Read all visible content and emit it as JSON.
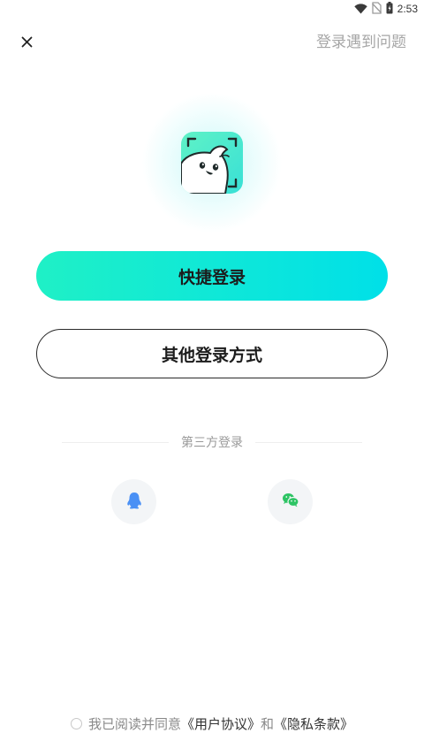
{
  "status_bar": {
    "time": "2:53",
    "icons": [
      "wifi-icon",
      "no-sim-icon",
      "battery-icon"
    ]
  },
  "top_bar": {
    "close_icon": "close-icon",
    "help_label": "登录遇到问题"
  },
  "logo": {
    "icon": "app-logo-bird",
    "colors": {
      "start": "#5ff2c6",
      "end": "#39e0d6"
    }
  },
  "buttons": {
    "quick_login": "快捷登录",
    "other_login": "其他登录方式"
  },
  "third_party": {
    "label": "第三方登录",
    "providers": [
      {
        "name": "QQ",
        "icon": "qq-icon",
        "color": "#4a90f5"
      },
      {
        "name": "WeChat",
        "icon": "wechat-icon",
        "color": "#2dc464"
      }
    ]
  },
  "agreement": {
    "prefix": "我已阅读并同意",
    "user_agreement": "《用户协议》",
    "conjunction": "和",
    "privacy_policy": "《隐私条款》"
  },
  "colors": {
    "accent_start": "#1ff0c6",
    "accent_end": "#00e0e8",
    "muted_text": "#a6a6a6"
  }
}
